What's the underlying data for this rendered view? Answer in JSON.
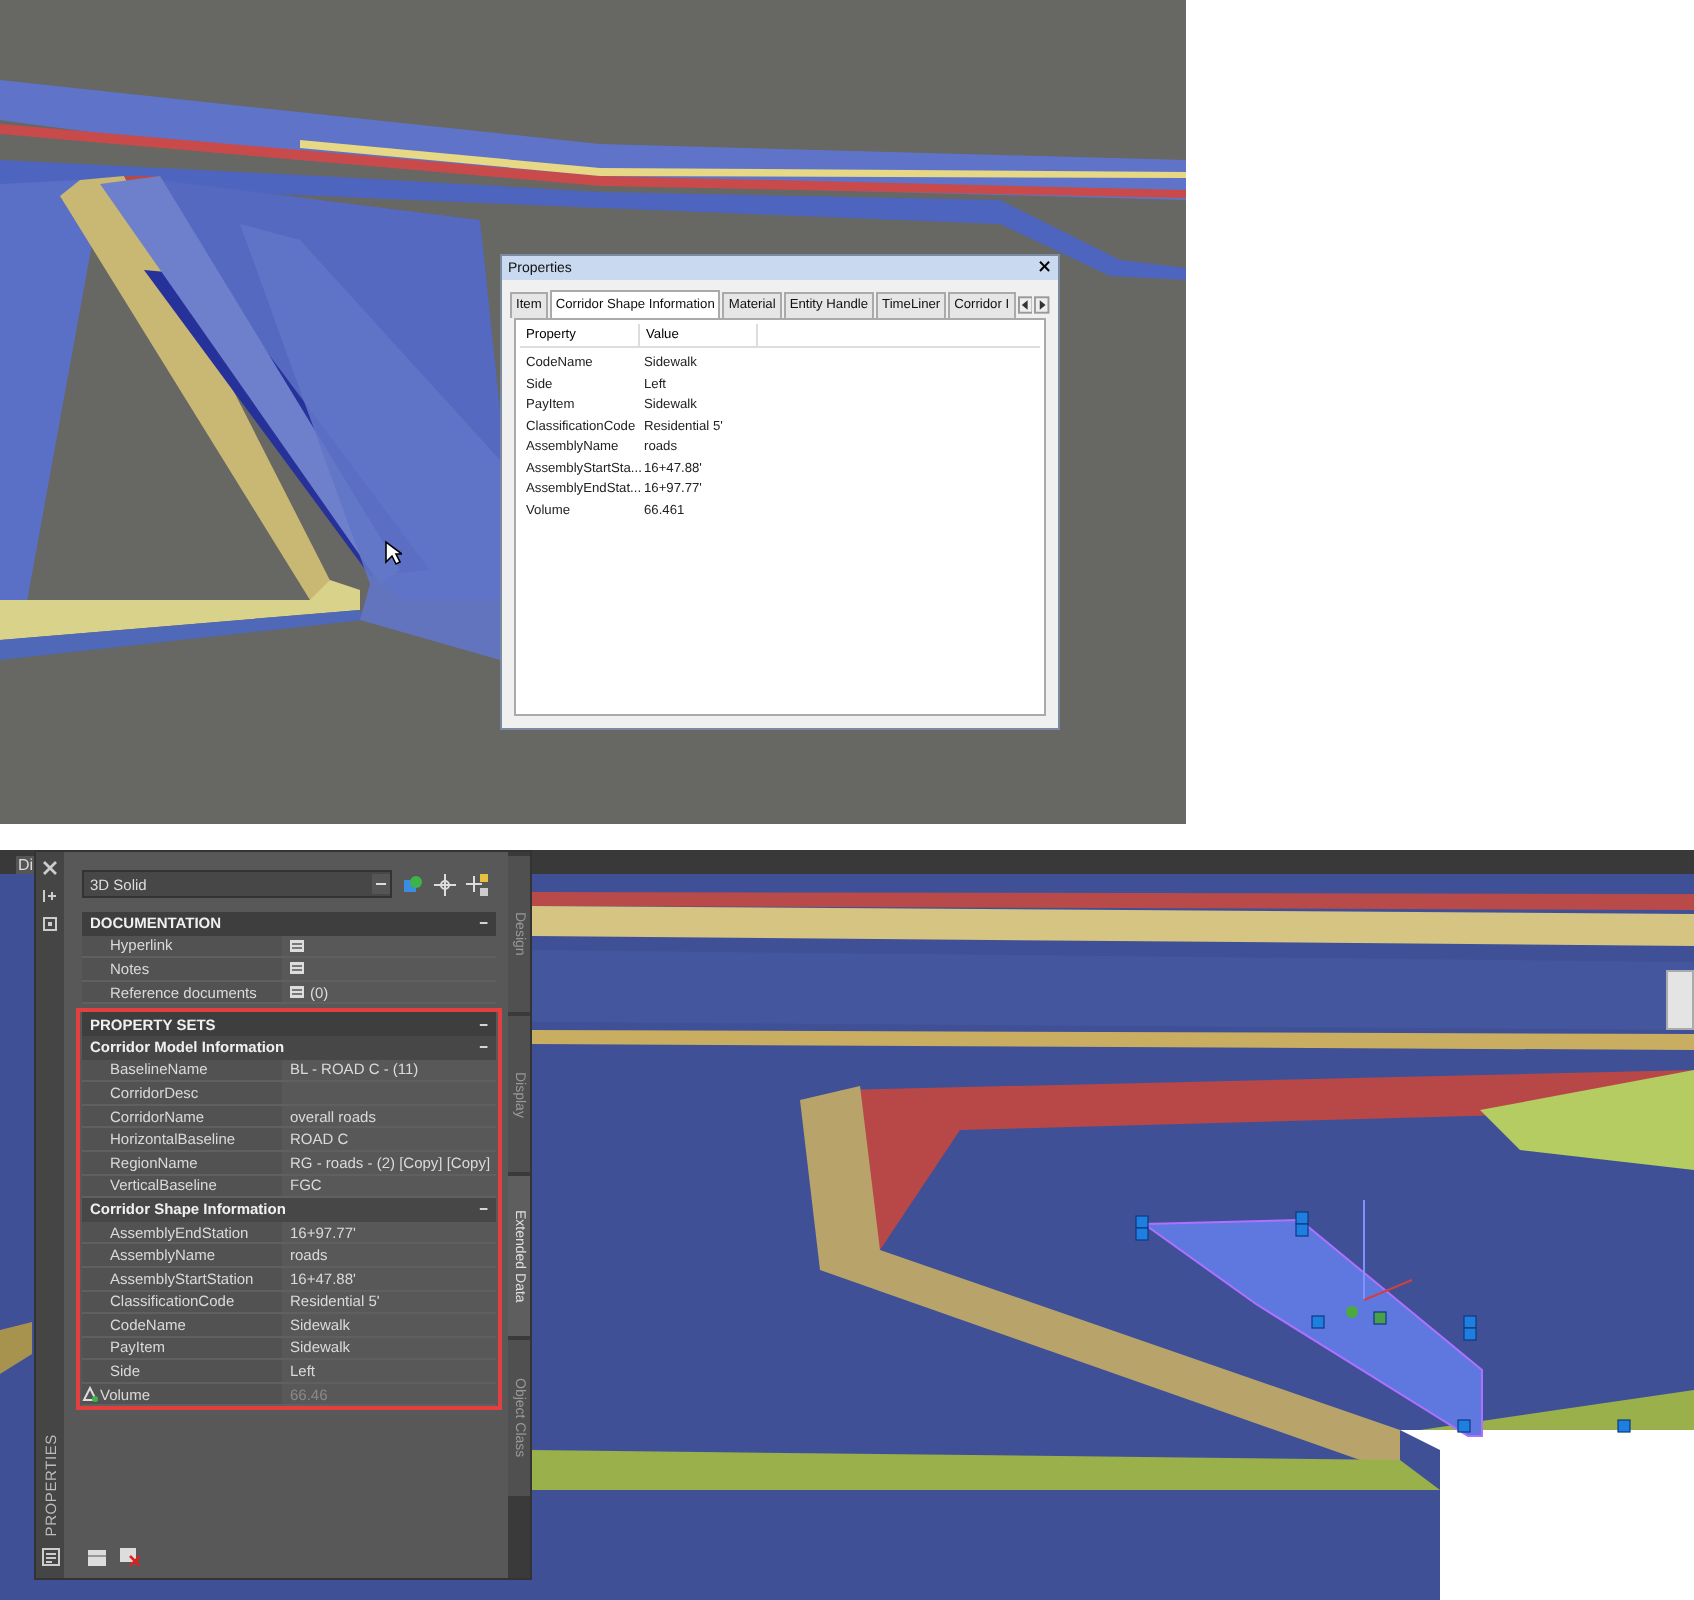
{
  "top_view": {
    "dialog": {
      "title": "Properties",
      "close": "×",
      "tabs": [
        {
          "label": "Item",
          "selected": false
        },
        {
          "label": "Corridor Shape Information",
          "selected": true
        },
        {
          "label": "Material",
          "selected": false
        },
        {
          "label": "Entity Handle",
          "selected": false
        },
        {
          "label": "TimeLiner",
          "selected": false
        },
        {
          "label": "Corridor I",
          "selected": false
        }
      ],
      "columns": [
        "Property",
        "Value"
      ],
      "rows": [
        {
          "property": "CodeName",
          "value": "Sidewalk"
        },
        {
          "property": "Side",
          "value": "Left"
        },
        {
          "property": "PayItem",
          "value": "Sidewalk"
        },
        {
          "property": "ClassificationCode",
          "value": "Residential 5'"
        },
        {
          "property": "AssemblyName",
          "value": "roads"
        },
        {
          "property": "AssemblyStartSta...",
          "value": "16+47.88'"
        },
        {
          "property": "AssemblyEndStat...",
          "value": "16+97.77'"
        },
        {
          "property": "Volume",
          "value": "66.461"
        }
      ]
    }
  },
  "bottom_view": {
    "palette": {
      "cut_tab": "Di",
      "title": "PROPERTIES",
      "object_type": "3D Solid",
      "side_tabs": [
        {
          "label": "Design",
          "selected": false
        },
        {
          "label": "Display",
          "selected": false
        },
        {
          "label": "Extended Data",
          "selected": true
        },
        {
          "label": "Object Class",
          "selected": false
        }
      ],
      "categories": [
        {
          "title": "DOCUMENTATION",
          "toggle": "−",
          "highlighted": false,
          "rows": [
            {
              "kind": "icon",
              "label": "Hyperlink"
            },
            {
              "kind": "icon",
              "label": "Notes"
            },
            {
              "kind": "icon",
              "label": "Reference documents",
              "value": "(0)"
            }
          ]
        },
        {
          "title": "PROPERTY SETS",
          "toggle": "−",
          "highlighted": true,
          "groups": [
            {
              "title": "Corridor Model Information",
              "toggle": "−",
              "rows": [
                {
                  "kind": "text",
                  "label": "BaselineName",
                  "value": "BL - ROAD C - (11)"
                },
                {
                  "kind": "text",
                  "label": "CorridorDesc"
                },
                {
                  "kind": "text",
                  "label": "CorridorName",
                  "value": "overall roads"
                },
                {
                  "kind": "text",
                  "label": "HorizontalBaseline",
                  "value": "ROAD C"
                },
                {
                  "kind": "text",
                  "label": "RegionName",
                  "value": "RG - roads - (2) [Copy] [Copy]"
                },
                {
                  "kind": "text",
                  "label": "VerticalBaseline",
                  "value": "FGC"
                }
              ]
            },
            {
              "title": "Corridor Shape Information",
              "toggle": "−",
              "rows": [
                {
                  "kind": "text",
                  "label": "AssemblyEndStation",
                  "value": "16+97.77'"
                },
                {
                  "kind": "text",
                  "label": "AssemblyName",
                  "value": "roads"
                },
                {
                  "kind": "text",
                  "label": "AssemblyStartStation",
                  "value": "16+47.88'"
                },
                {
                  "kind": "text",
                  "label": "ClassificationCode",
                  "value": "Residential 5'"
                },
                {
                  "kind": "text",
                  "label": "CodeName",
                  "value": "Sidewalk"
                },
                {
                  "kind": "text",
                  "label": "PayItem",
                  "value": "Sidewalk"
                },
                {
                  "kind": "text",
                  "label": "Side",
                  "value": "Left"
                },
                {
                  "kind": "computed",
                  "label": "Volume",
                  "value": "66.46"
                }
              ]
            }
          ]
        }
      ]
    }
  }
}
